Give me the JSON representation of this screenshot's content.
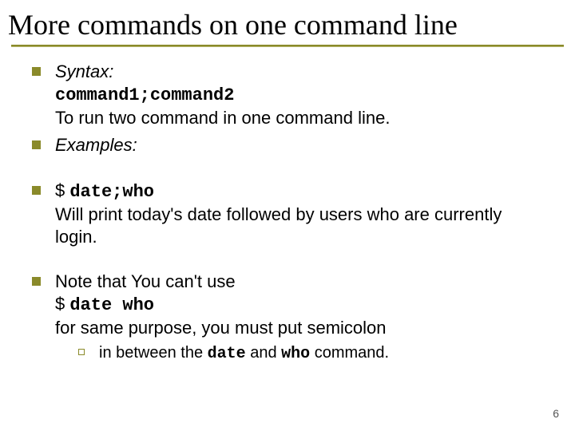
{
  "title": "More commands on one command line",
  "b1": {
    "label": "Syntax:",
    "code": "command1;command2",
    "desc": "To run two command in one command line."
  },
  "b2": {
    "label": "Examples:"
  },
  "b3": {
    "prefix": "$ ",
    "code": "date;who",
    "desc": "Will print today's date followed by users who are currently login."
  },
  "b4": {
    "line1": "Note that You can't use",
    "prefix": "$ ",
    "code": "date who",
    "line3": "for same purpose, you must put semicolon",
    "sub_pre": "in between the ",
    "sub_c1": "date",
    "sub_mid": " and ",
    "sub_c2": "who",
    "sub_post": " command."
  },
  "page_number": "6"
}
